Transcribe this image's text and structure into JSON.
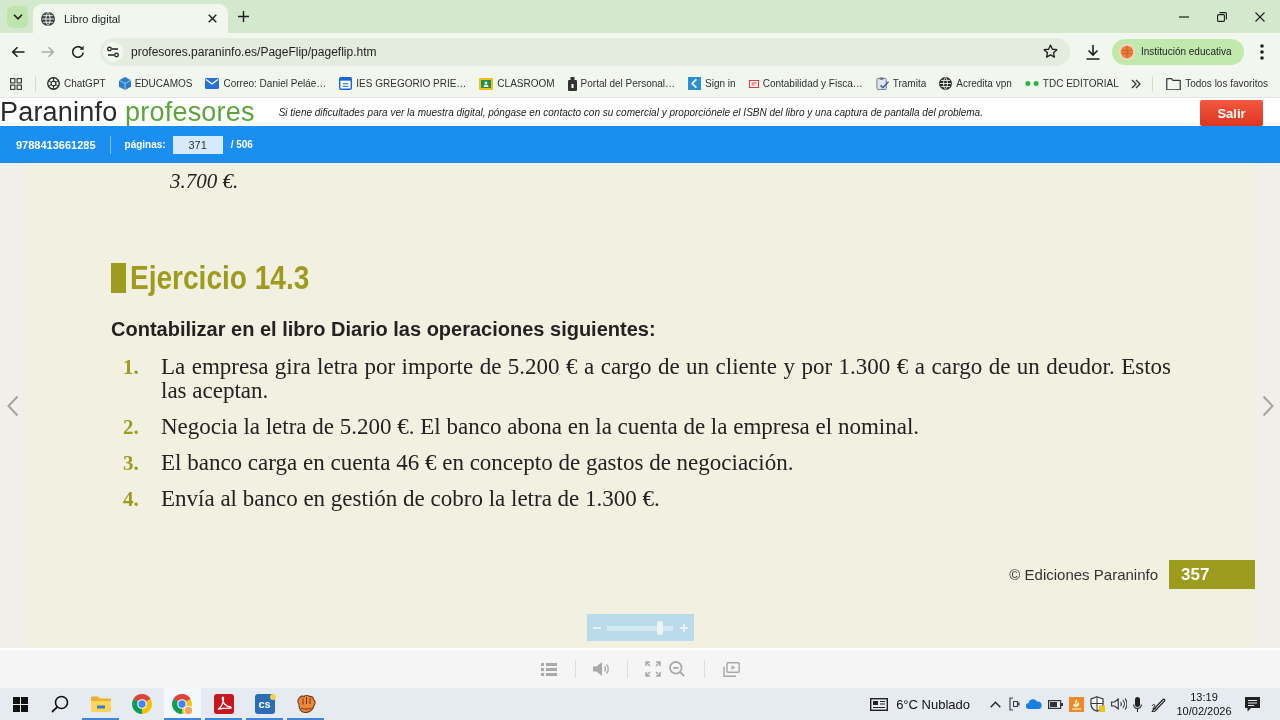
{
  "browser": {
    "tabs": [
      {
        "title": "Libro digital",
        "selected": true
      }
    ],
    "forward_disabled": true,
    "url": "profesores.paraninfo.es/PageFlip/pageflip.htm",
    "profile": "Institución educativa",
    "bookmarks": [
      {
        "kind": "knot",
        "label": "ChatGPT"
      },
      {
        "kind": "cube",
        "label": "EDUCAMOS"
      },
      {
        "kind": "mail",
        "label": "Correo: Daniel Peláe…"
      },
      {
        "kind": "calendar",
        "label": "IES GREGORIO PRIE…"
      },
      {
        "kind": "board",
        "label": "CLASROOM"
      },
      {
        "kind": "tower",
        "label": "Portal del Personal…"
      },
      {
        "kind": "arrow",
        "label": "Sign in"
      },
      {
        "kind": "doc",
        "label": "Contabilidad y Fisca…"
      },
      {
        "kind": "clipboard",
        "label": "Tramita"
      },
      {
        "kind": "globe",
        "label": "Acredita vpn"
      },
      {
        "kind": "dots",
        "label": "TDC EDITORIAL"
      }
    ],
    "all_bookmarks": "Todos los favoritos"
  },
  "site_header": {
    "logo": "Paraninfo",
    "logo_accent": "profesores",
    "notice": "Si tiene dificultades para ver la muestra digital, póngase en contacto con su comercial y proporciónele el ISBN del libro y una captura de pantalla del problema.",
    "logout": "Salir"
  },
  "viewer_bar": {
    "isbn": "9788413661285",
    "pages_label": "páginas:",
    "page": "371",
    "total": "/ 506"
  },
  "page": {
    "cut_text": "3.700 €.",
    "exercise_title": "Ejercicio 14.3",
    "instruction": "Contabilizar en el libro Diario las operaciones siguientes:",
    "items": [
      {
        "number": "1.",
        "text": "La empresa gira letra por importe de 5.200 € a cargo de un cliente y por 1.300 € a cargo de un deudor. Estos las aceptan."
      },
      {
        "number": "2.",
        "text": "Negocia la letra de 5.200 €. El banco abona en la cuenta de la empresa el nominal."
      },
      {
        "number": "3.",
        "text": "El banco carga en cuenta 46 € en concepto de gastos de negociación."
      },
      {
        "number": "4.",
        "text": "Envía al banco en gestión de cobro la letra de 1.300 €."
      }
    ],
    "copyright": "© Ediciones Paraninfo",
    "page_number": "357"
  },
  "zoom": {
    "level": 0.8
  },
  "taskbar": {
    "apps": [
      {
        "kind": "explorer",
        "running": true,
        "selected": false
      },
      {
        "kind": "browser",
        "running": false,
        "selected": false
      },
      {
        "kind": "browserprofile",
        "running": true,
        "selected": true
      },
      {
        "kind": "reader",
        "running": true,
        "selected": false
      },
      {
        "kind": "tile",
        "label": "cs",
        "running": true,
        "selected": false
      },
      {
        "kind": "glove",
        "running": true,
        "selected": false
      }
    ],
    "weather": "6°C Nublado",
    "time": "13:19",
    "date": "10/02/2026"
  }
}
